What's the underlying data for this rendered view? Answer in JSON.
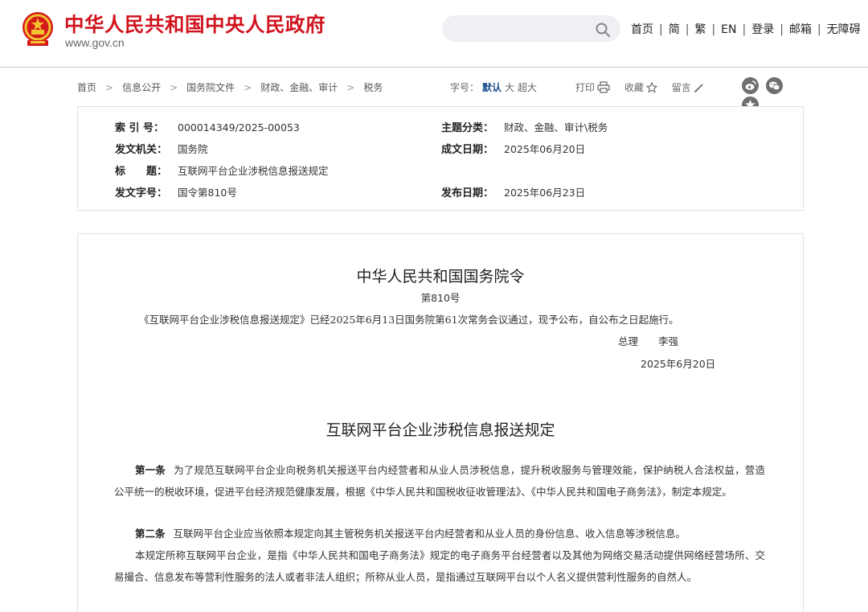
{
  "site": {
    "title": "中华人民共和国中央人民政府",
    "domain": "www.gov.cn"
  },
  "search": {
    "placeholder": ""
  },
  "topnav": [
    "首页",
    "简",
    "繁",
    "EN",
    "登录",
    "邮箱",
    "无障碍"
  ],
  "breadcrumb": [
    "首页",
    "信息公开",
    "国务院文件",
    "财政、金融、审计",
    "税务"
  ],
  "font_size": {
    "label": "字号：",
    "options": [
      "默认",
      "大",
      "超大"
    ],
    "selected": "默认"
  },
  "actions": {
    "print": "打印",
    "favorite": "收藏",
    "comment": "留言"
  },
  "share_icons": [
    "weibo-icon",
    "wechat-icon",
    "favorite-star-icon"
  ],
  "info": {
    "index_label": "索 引 号：",
    "index_value": "000014349/2025-00053",
    "topic_label": "主题分类：",
    "topic_value": "财政、金融、审计\\税务",
    "issuer_label": "发文机关：",
    "issuer_value": "国务院",
    "written_label": "成文日期：",
    "written_value": "2025年06月20日",
    "title_label": "标　　题：",
    "title_value": "互联网平台企业涉税信息报送规定",
    "docno_label": "发文字号：",
    "docno_value": "国令第810号",
    "published_label": "发布日期：",
    "published_value": "2025年06月23日"
  },
  "document": {
    "order_title": "中华人民共和国国务院令",
    "order_no": "第810号",
    "intro": "《互联网平台企业涉税信息报送规定》已经2025年6月13日国务院第61次常务会议通过，现予公布，自公布之日起施行。",
    "signature": "总理　　李强",
    "sign_date": "2025年6月20日",
    "regulation_title": "互联网平台企业涉税信息报送规定",
    "articles": [
      {
        "label": "第一条",
        "text": "为了规范互联网平台企业向税务机关报送平台内经营者和从业人员涉税信息，提升税收服务与管理效能，保护纳税人合法权益，营造公平统一的税收环境，促进平台经济规范健康发展，根据《中华人民共和国税收征收管理法》、《中华人民共和国电子商务法》，制定本规定。"
      },
      {
        "label": "第二条",
        "text": "互联网平台企业应当依照本规定向其主管税务机关报送平台内经营者和从业人员的身份信息、收入信息等涉税信息。"
      },
      {
        "label": "",
        "text": "本规定所称互联网平台企业，是指《中华人民共和国电子商务法》规定的电子商务平台经营者以及其他为网络交易活动提供网络经营场所、交易撮合、信息发布等营利性服务的法人或者非法人组织；所称从业人员，是指通过互联网平台以个人名义提供营利性服务的自然人。"
      }
    ]
  },
  "colors": {
    "brand_red": "#d0131e",
    "link_blue": "#1a4d8f",
    "icon_gray": "#6f6f6f"
  }
}
